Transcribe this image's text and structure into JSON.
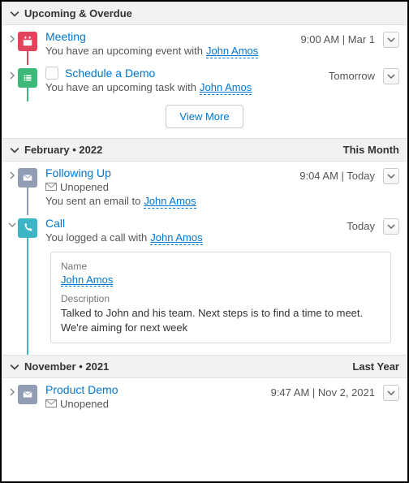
{
  "sections": {
    "upcoming": {
      "title": "Upcoming & Overdue",
      "items": {
        "meeting": {
          "title": "Meeting",
          "body": "You have an upcoming event with",
          "who": "John Amos",
          "meta": "9:00 AM | Mar 1"
        },
        "demo": {
          "title": "Schedule a Demo",
          "body": "You have an upcoming task with",
          "who": "John Amos",
          "meta": "Tomorrow"
        }
      },
      "view_more": "View More"
    },
    "feb": {
      "title": "February • 2022",
      "badge": "This Month",
      "items": {
        "follow": {
          "title": "Following Up",
          "status": "Unopened",
          "body": "You sent an email to",
          "who": "John Amos",
          "meta": "9:04 AM | Today"
        },
        "call": {
          "title": "Call",
          "body": "You logged a call with",
          "who": "John Amos",
          "meta": "Today",
          "detail": {
            "name_label": "Name",
            "name_value": "John Amos",
            "desc_label": "Description",
            "desc_value": "Talked to John and his team. Next steps is to find a time to meet. We're aiming for next week"
          }
        }
      }
    },
    "nov": {
      "title": "November • 2021",
      "badge": "Last Year",
      "items": {
        "prod": {
          "title": "Product Demo",
          "status": "Unopened",
          "meta": "9:47 AM | Nov 2, 2021"
        }
      }
    }
  }
}
